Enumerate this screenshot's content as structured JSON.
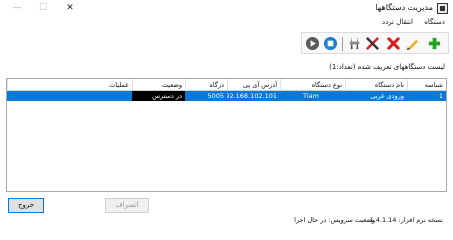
{
  "window": {
    "title": "مدیریت دستگاهها",
    "min_glyph": "—",
    "max_glyph": "☐",
    "close_glyph": "✕"
  },
  "menu": [
    "دستگاه",
    "انتقال تردد"
  ],
  "toolbar": {
    "buttons": [
      "play-icon",
      "stop-icon",
      "settings-icon",
      "tools-icon",
      "delete-icon",
      "edit-icon",
      "add-icon"
    ],
    "colors": {
      "play": "#5b5b5b",
      "stop": "#1d7fd2",
      "delete": "#d71e1e",
      "edit": "#f3b21b",
      "add": "#23a122"
    }
  },
  "list": {
    "title": "لیست دستگاههای تعریف شده (تعداد:1)",
    "columns": [
      "شناسه",
      "نام دستگاه",
      "نوع دستگاه",
      "آدرس آی پی",
      "درگاه",
      "وضعیت",
      "عملیات"
    ],
    "rows": [
      {
        "id": "1",
        "name": "ورودی غربی",
        "type": "Tiam",
        "ip": "192.168.102.101",
        "port": "5005",
        "status": "در دسترس",
        "ops": ""
      }
    ],
    "row_color": "#0a78d7"
  },
  "buttons": {
    "exit": "خروج",
    "cancel": "انصراف"
  },
  "status": {
    "app_version": "نسخه نرم افزار: 1.4.1.14",
    "service_status": "وضعیت سرویس: در حال اجرا"
  }
}
